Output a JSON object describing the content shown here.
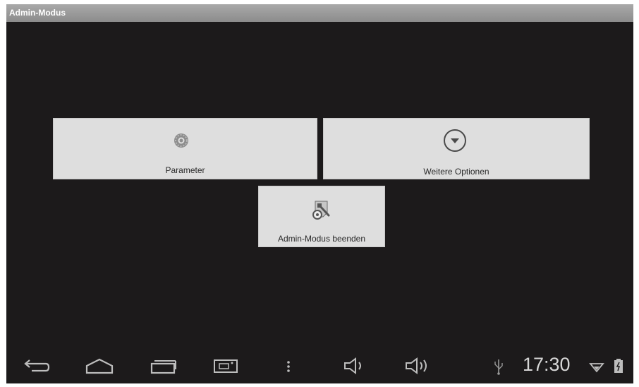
{
  "window": {
    "title": "Admin-Modus"
  },
  "tiles": {
    "parameter": {
      "label": "Parameter",
      "icon": "gear-icon"
    },
    "weitere": {
      "label": "Weitere Optionen",
      "icon": "dropdown-circle-icon"
    },
    "admin_exit": {
      "label": "Admin-Modus beenden",
      "icon": "tools-icon"
    }
  },
  "status": {
    "time": "17:30"
  },
  "colors": {
    "background": "#1c1a1b",
    "tile": "#dedede",
    "titlebar": "#9a9a9a",
    "navbar_icon": "#bdbdbd"
  }
}
